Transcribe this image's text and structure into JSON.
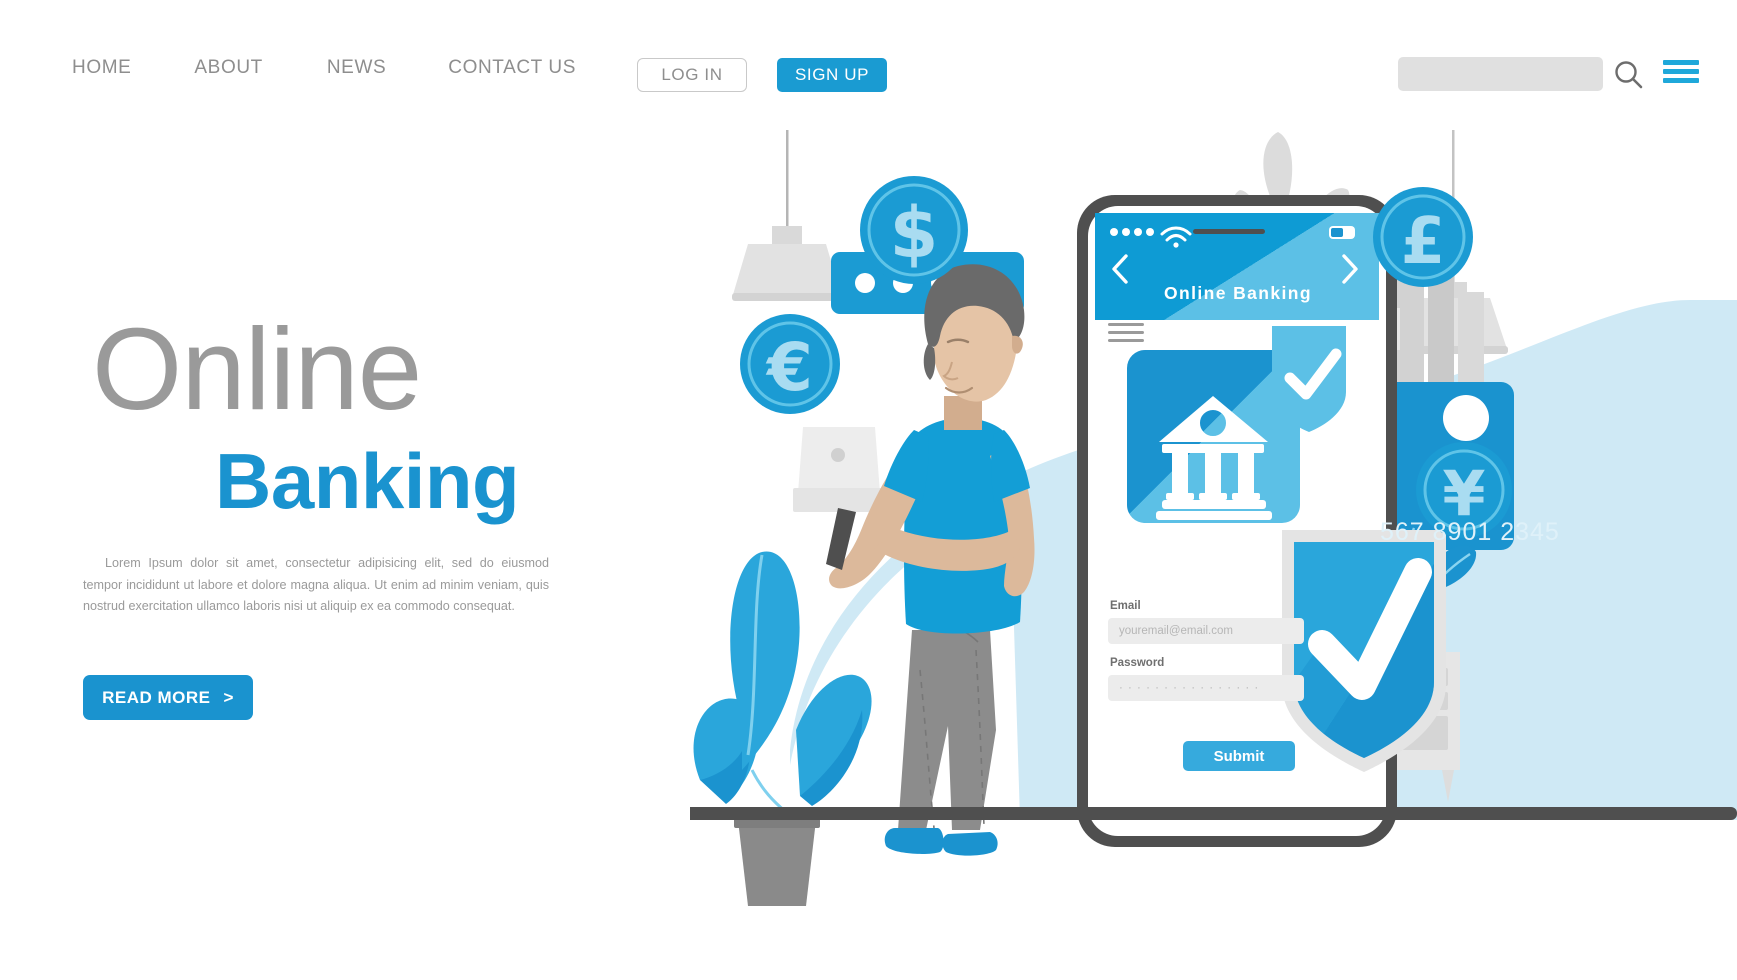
{
  "nav": {
    "links": [
      {
        "label": "HOME"
      },
      {
        "label": "ABOUT"
      },
      {
        "label": "NEWS"
      },
      {
        "label": "CONTACT US"
      }
    ],
    "login_label": "LOG IN",
    "signup_label": "SIGN UP",
    "search_placeholder": "",
    "search_value": ""
  },
  "hero": {
    "title_line1": "Online",
    "title_line2": "Banking",
    "paragraph": "Lorem Ipsum dolor sit amet, consectetur adipisicing elit, sed do eiusmod tempor incididunt ut labore et dolore magna aliqua. Ut enim ad minim veniam, quis nostrud exercitation ullamco laboris nisi ut aliquip ex ea commodo consequat.",
    "cta_label": "READ MORE",
    "cta_chevron": ">"
  },
  "phone": {
    "app_title": "Online Banking",
    "back_arrow": "‹",
    "forward_arrow": "›",
    "email_label": "Email",
    "email_placeholder": "youremail@email.com",
    "password_label": "Password",
    "password_value": "· · · · · · · · · · · · · · · ·",
    "submit_label": "Submit"
  },
  "card": {
    "number": "567 8901 2345"
  },
  "coins": [
    {
      "symbol": "$",
      "name": "dollar"
    },
    {
      "symbol": "€",
      "name": "euro"
    },
    {
      "symbol": "£",
      "name": "pound"
    },
    {
      "symbol": "¥",
      "name": "yen"
    }
  ],
  "colors": {
    "brand_blue": "#1a9bd2",
    "deep_blue": "#1a93cf",
    "light_blue": "#39b0e0",
    "pale_blue": "#cfe9f5",
    "grey_text": "#9a9a9a",
    "dark_grey": "#4f4f4f"
  }
}
